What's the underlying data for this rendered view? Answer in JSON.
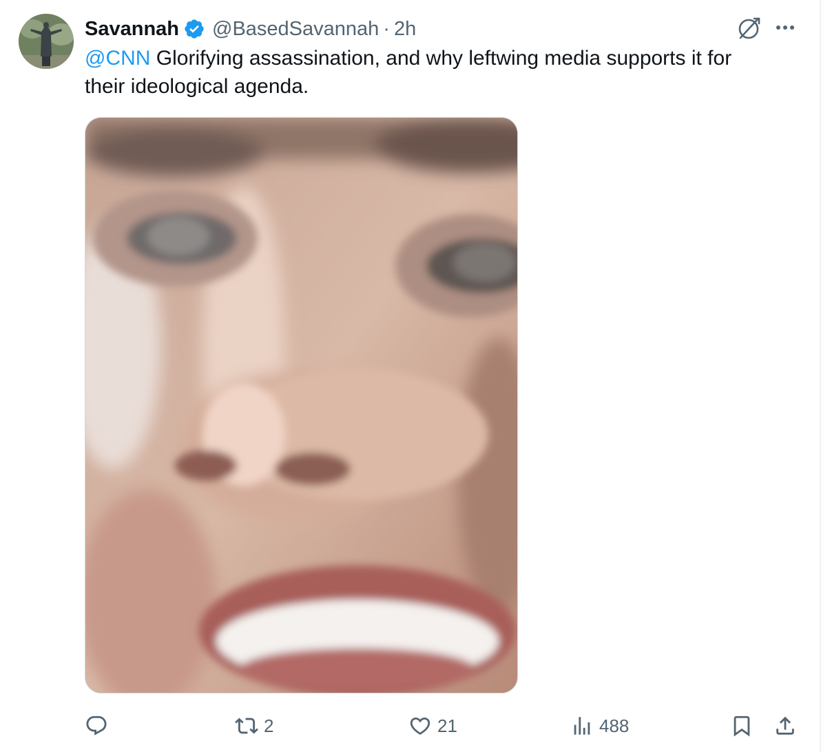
{
  "tweet": {
    "author": {
      "name": "Savannah",
      "handle": "@BasedSavannah",
      "separator": "·",
      "time": "2h",
      "verified": true,
      "avatar_icon": "statue-avatar"
    },
    "text": {
      "mention": "@CNN",
      "body": " Glorifying assassination, and why leftwing media supports it for their ideological agenda."
    },
    "media": {
      "type": "image"
    },
    "actions": {
      "reply": {
        "icon": "reply-icon",
        "count": ""
      },
      "retweet": {
        "icon": "retweet-icon",
        "count": "2"
      },
      "like": {
        "icon": "heart-icon",
        "count": "21"
      },
      "views": {
        "icon": "views-icon",
        "count": "488"
      },
      "bookmark": {
        "icon": "bookmark-icon"
      },
      "share": {
        "icon": "share-icon"
      }
    },
    "colors": {
      "accent": "#1d9bf0",
      "secondary_text": "#536471",
      "primary_text": "#0f1419"
    }
  }
}
